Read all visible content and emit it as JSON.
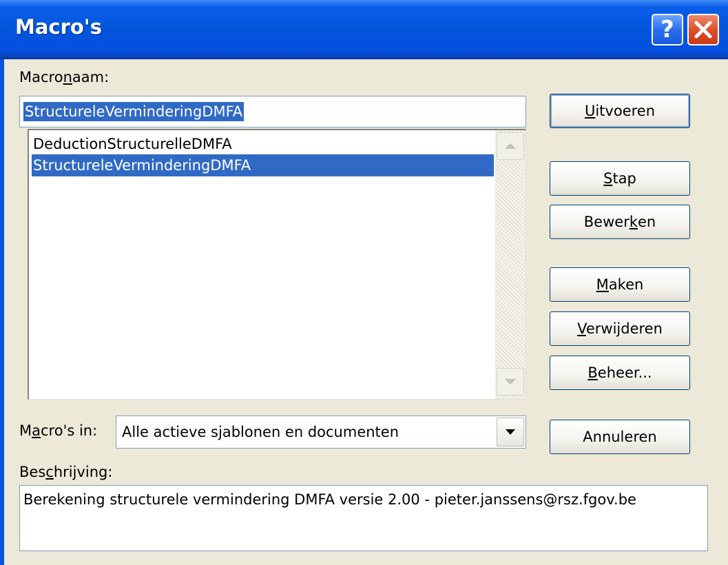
{
  "window": {
    "title": "Macro's",
    "help_glyph": "?",
    "close_glyph": "close-icon"
  },
  "macro_name": {
    "label_before": "Macro",
    "label_accel": "n",
    "label_after": "aam:",
    "value": "StructureleVerminderingDMFA"
  },
  "macro_list": {
    "items": [
      {
        "label": "DeductionStructurelleDMFA",
        "selected": false
      },
      {
        "label": "StructureleVerminderingDMFA",
        "selected": true
      }
    ]
  },
  "buttons": {
    "run": "Uitvoeren",
    "step": "Stap",
    "edit_before": "Bewer",
    "edit_accel": "k",
    "edit_after": "en",
    "create": "Maken",
    "delete": "Verwijderen",
    "organizer": "Beheer...",
    "cancel": "Annuleren"
  },
  "macros_in": {
    "label_before": "M",
    "label_accel": "a",
    "label_after": "cro's in:",
    "value": "Alle actieve sjablonen en documenten"
  },
  "description": {
    "label_before": "Bes",
    "label_accel": "c",
    "label_after": "hrijving:",
    "value": "Berekening structurele vermindering DMFA versie 2.00 -  pieter.janssens@rsz.fgov.be"
  },
  "colors": {
    "titlebar": "#0355dc",
    "selection": "#316ac5",
    "dialog_bg": "#ece9d8",
    "close_button": "#e0502a"
  }
}
